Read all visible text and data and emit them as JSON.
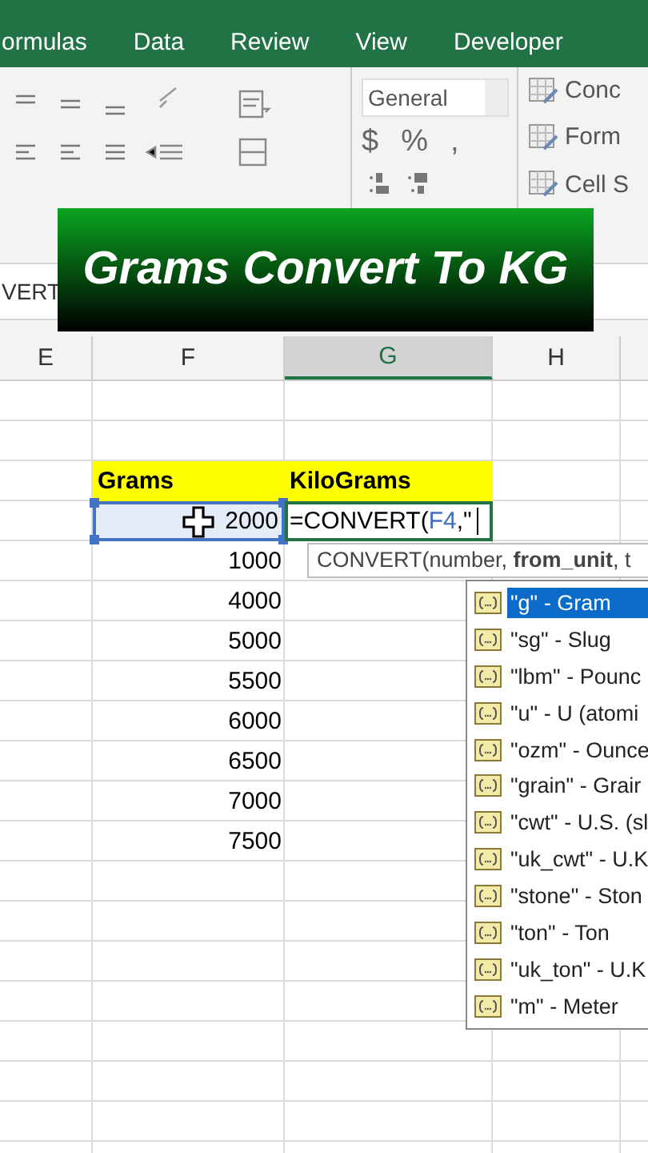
{
  "ribbon_tabs": [
    {
      "label": "ormulas"
    },
    {
      "label": "Data"
    },
    {
      "label": "Review"
    },
    {
      "label": "View"
    },
    {
      "label": "Developer"
    }
  ],
  "number_format": {
    "value": "General",
    "symbols": [
      "$",
      "%",
      ","
    ]
  },
  "styles": [
    {
      "label": "Conc"
    },
    {
      "label": "Form"
    },
    {
      "label": "Cell S"
    }
  ],
  "formula_bar": {
    "value": "VERT"
  },
  "banner": {
    "title": "Grams Convert To KG"
  },
  "columns": [
    {
      "label": "E",
      "selected": false
    },
    {
      "label": "F",
      "selected": false
    },
    {
      "label": "G",
      "selected": true
    },
    {
      "label": "H",
      "selected": false
    }
  ],
  "table": {
    "headers": [
      "Grams",
      "KiloGrams"
    ],
    "values": [
      "2000",
      "1000",
      "4000",
      "5000",
      "5500",
      "6000",
      "6500",
      "7000",
      "7500"
    ]
  },
  "edit_cell": {
    "prefix": "=CONVERT(",
    "ref": "F4",
    "suffix": ",\""
  },
  "tooltip": "CONVERT(number, **from_unit**, t",
  "dropdown": [
    {
      "label": "\"g\" - Gram",
      "selected": true
    },
    {
      "label": "\"sg\" - Slug",
      "selected": false
    },
    {
      "label": "\"lbm\" - Pounc",
      "selected": false
    },
    {
      "label": "\"u\" - U (atomi",
      "selected": false
    },
    {
      "label": "\"ozm\" - Ounce",
      "selected": false
    },
    {
      "label": "\"grain\" - Grair",
      "selected": false
    },
    {
      "label": "\"cwt\" - U.S. (sl",
      "selected": false
    },
    {
      "label": "\"uk_cwt\" - U.K",
      "selected": false
    },
    {
      "label": "\"stone\" - Ston",
      "selected": false
    },
    {
      "label": "\"ton\" - Ton",
      "selected": false
    },
    {
      "label": "\"uk_ton\" - U.K",
      "selected": false
    },
    {
      "label": "\"m\" - Meter",
      "selected": false
    }
  ]
}
